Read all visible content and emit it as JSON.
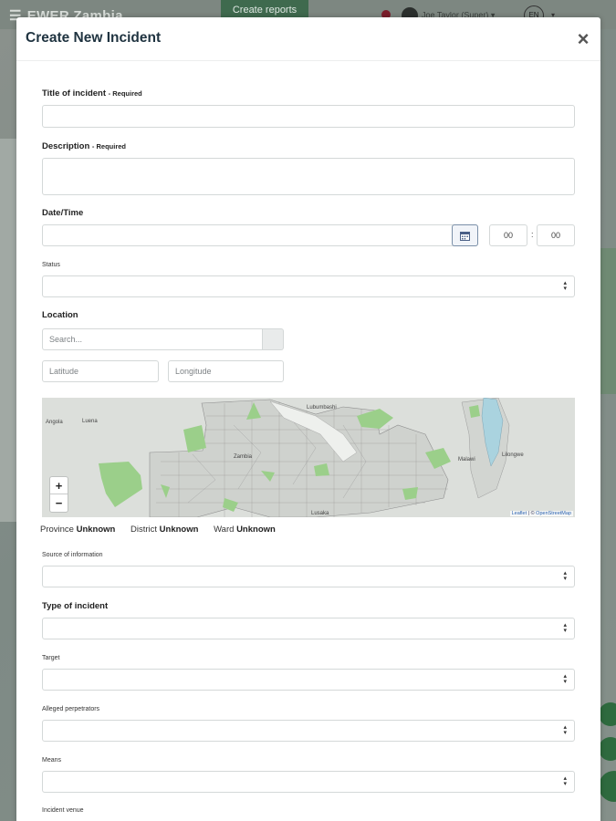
{
  "background": {
    "brand": "EWER Zambia",
    "create_reports_label": "Create reports",
    "user_name": "Joe Taylor (Super)",
    "lang": "EN"
  },
  "modal": {
    "title": "Create New Incident",
    "close_label": "×"
  },
  "form": {
    "title_label": "Title of incident",
    "title_required": "- Required",
    "title_value": "",
    "description_label": "Description",
    "description_required": "- Required",
    "description_value": "",
    "datetime_label": "Date/Time",
    "date_value": "",
    "hour_value": "00",
    "minute_value": "00",
    "time_separator": ":",
    "status_label": "Status",
    "status_value": "",
    "location_label": "Location",
    "search_placeholder": "Search...",
    "latitude_placeholder": "Latitude",
    "longitude_placeholder": "Longitude",
    "source_label": "Source of information",
    "type_label": "Type of incident",
    "target_label": "Target",
    "perpetrators_label": "Alleged perpetrators",
    "means_label": "Means",
    "venue_label": "Incident venue"
  },
  "map": {
    "labels": [
      "Angola",
      "Luena",
      "Lubumbashi",
      "Zambia",
      "Malawi",
      "Lilongwe",
      "Lusaka"
    ],
    "zoom_in": "+",
    "zoom_out": "−",
    "attribution_leaflet": "Leaflet",
    "attribution_sep": " | © ",
    "attribution_osm": "OpenStreetMap"
  },
  "admin": {
    "province_label": "Province",
    "province_value": "Unknown",
    "district_label": "District",
    "district_value": "Unknown",
    "ward_label": "Ward",
    "ward_value": "Unknown"
  },
  "colors": {
    "title": "#1f3340",
    "background_green": "#3f6a4e",
    "map_land": "#d9dcd8",
    "map_green": "#9bcf8a",
    "map_water": "#aad3df"
  }
}
